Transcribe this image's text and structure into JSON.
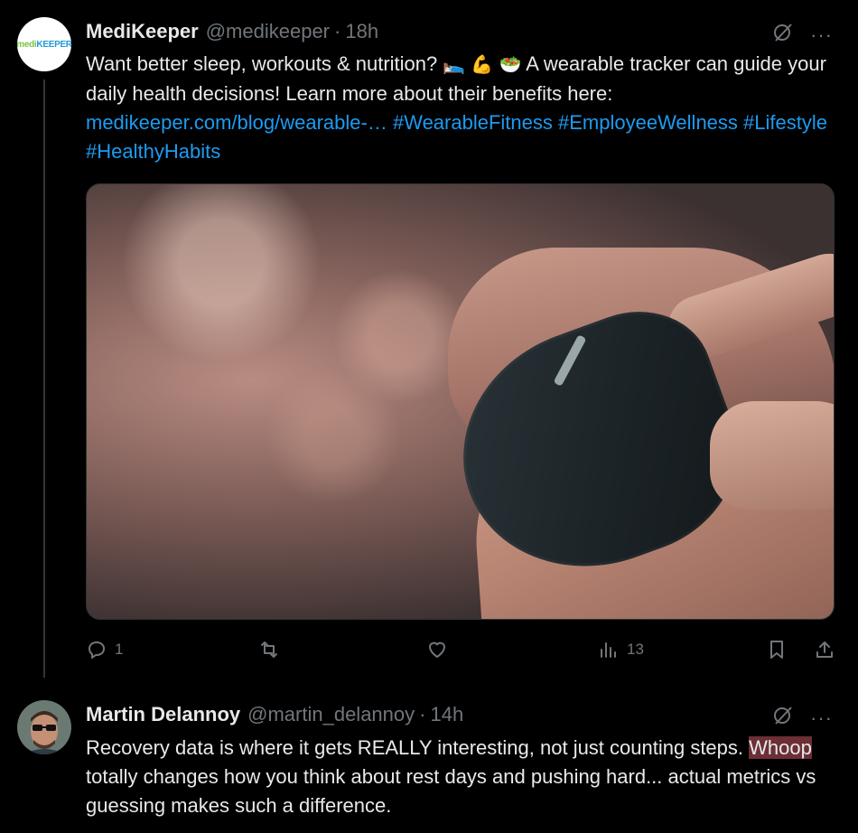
{
  "tweets": [
    {
      "author": {
        "name": "MediKeeper",
        "handle": "@medikeeper",
        "time": "18h",
        "avatar_logo_a": "medi",
        "avatar_logo_b": "KEEPER"
      },
      "text": {
        "part1": "Want better sleep, workouts & nutrition? ",
        "emoji_bed": "🛌",
        "emoji_muscle": "💪",
        "emoji_salad": "🥗",
        "part2": " A wearable tracker can guide your daily health decisions! Learn more about their benefits here: ",
        "link": "medikeeper.com/blog/wearable-…",
        "tags": [
          "#WearableFitness",
          "#EmployeeWellness",
          "#Lifestyle",
          "#HealthyHabits"
        ]
      },
      "media": {
        "description": "close-up of wrist with fitness tracker"
      },
      "actions": {
        "replies": "1",
        "retweets": "",
        "likes": "",
        "views": "13"
      }
    },
    {
      "author": {
        "name": "Martin Delannoy",
        "handle": "@martin_delannoy",
        "time": "14h"
      },
      "text": {
        "line1": "Recovery data is where it gets REALLY interesting, not just counting steps. ",
        "highlight": "Whoop",
        "line2": " totally changes how you think about rest days and pushing hard... actual metrics vs guessing makes such a difference."
      }
    }
  ],
  "ui": {
    "more": "···",
    "colors": {
      "link": "#1d9bf0",
      "muted": "#71767b",
      "text": "#e7e9ea",
      "bg": "#000000"
    }
  }
}
